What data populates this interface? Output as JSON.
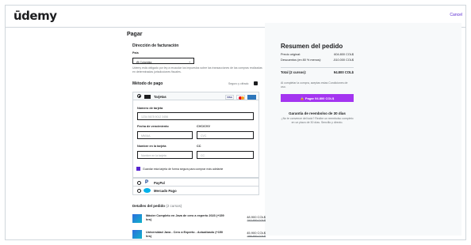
{
  "header": {
    "logo": "ūdemy",
    "cancel_label": "Cancel"
  },
  "checkout": {
    "title": "Pagar",
    "billing_title": "Dirección de facturación",
    "country_label": "País",
    "country_value": "Colombia",
    "billing_note": "Udemy está obligado por ley a recaudar los impuestos sobre las transacciones de las compras realizadas en determinadas jurisdicciones fiscales.",
    "payment_title": "Método de pago",
    "secure_label": "Seguro y cifrado",
    "cards_label": "Tarjetas",
    "card_number_label": "Número de tarjeta",
    "card_number_placeholder": "1234 5678 9012 3456",
    "expiry_label": "Fecha de vencimiento",
    "expiry_placeholder": "MM/AA",
    "cvc_label": "CVC/CVV",
    "cvc_placeholder": "CVC",
    "name_label": "Nombre en la tarjeta",
    "name_placeholder": "Nombre en la tarjeta",
    "cc_label": "CC",
    "cc_placeholder": "CC",
    "save_card_label": "Guardar esta tarjeta de forma segura para comprar más adelante",
    "paypal_label": "PayPal",
    "mercado_label": "Mercado Pago",
    "order_details_title": "Detalles del pedido",
    "order_details_count": "(2 cursos)",
    "courses": [
      {
        "title": "Máster Completo en Java de cero a experto 2023 (+159 hrs)",
        "price": "48.900 COL$",
        "old_price": "342.900 COL$"
      },
      {
        "title": "Universidad Java - Cero a Experto - Actualizado (+150 hrs)",
        "price": "45.900 COL$",
        "old_price": "299.900 COL$"
      }
    ]
  },
  "summary": {
    "title": "Resumen del pedido",
    "original_label": "Precio original:",
    "original_value": "604.800 COL$",
    "discount_label": "Descuentos (en 80 % menos):",
    "discount_value": "-510.000 COL$",
    "total_label": "Total (2 cursos):",
    "total_value": "94.800 COL$",
    "terms_note": "Al completar la compra, aceptas estas Condiciones de uso.",
    "pay_button": "Pagar 94.800 COL$",
    "guarantee_title": "Garantía de reembolso de 30 días",
    "guarantee_text": "¿No te convence del todo? Recibe un reembolso completo en un plazo de 30 días. Sencillo y directo."
  },
  "colors": {
    "accent": "#a435f0",
    "brand": "#5624d0"
  }
}
